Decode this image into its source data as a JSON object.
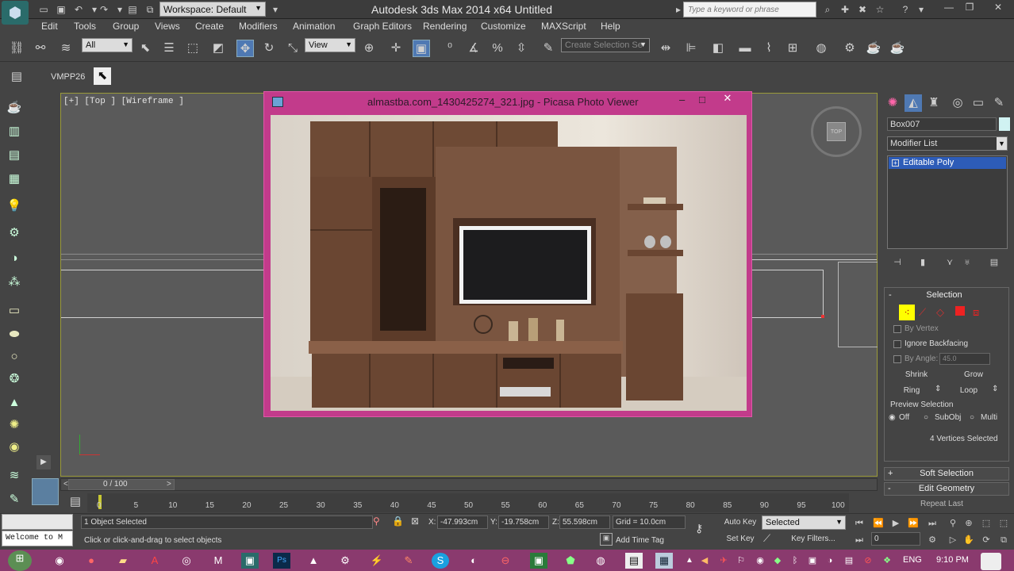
{
  "titlebar": {
    "app_icon": "3ds-max-logo-icon",
    "workspace": "Workspace: Default",
    "title": "Autodesk 3ds Max  2014 x64       Untitled",
    "search_placeholder": "Type a keyword or phrase"
  },
  "menubar": [
    "Edit",
    "Tools",
    "Group",
    "Views",
    "Create",
    "Modifiers",
    "Animation",
    "Graph Editors",
    "Rendering",
    "Customize",
    "MAXScript",
    "Help"
  ],
  "toolbar": {
    "selection_filter": "All",
    "ref_coord": "View",
    "named_selection_placeholder": "Create Selection Se"
  },
  "ribbon": {
    "label": "VMPP26"
  },
  "viewport": {
    "label": "[+] [Top ] [Wireframe ]"
  },
  "picasa": {
    "title": "almastba.com_1430425274_321.jpg - Picasa Photo Viewer",
    "min": "‒",
    "max": "□",
    "close": "✕"
  },
  "command_panel": {
    "object_name": "Box007",
    "modifier_list": "Modifier List",
    "stack_item": "Editable Poly",
    "selection_rollout": "Selection",
    "by_vertex": "By Vertex",
    "ignore_backfacing": "Ignore Backfacing",
    "by_angle": "By Angle:",
    "angle_value": "45.0",
    "shrink": "Shrink",
    "grow": "Grow",
    "ring": "Ring",
    "loop": "Loop",
    "preview_selection": "Preview Selection",
    "preview_off": "Off",
    "preview_subobj": "SubObj",
    "preview_multi": "Multi",
    "selected_info": "4 Vertices Selected",
    "soft_selection": "Soft Selection",
    "edit_geometry": "Edit Geometry",
    "repeat_last": "Repeat Last"
  },
  "timeline": {
    "position": "0 / 100",
    "ticks": [
      "0",
      "5",
      "10",
      "15",
      "20",
      "25",
      "30",
      "35",
      "40",
      "45",
      "50",
      "55",
      "60",
      "65",
      "70",
      "75",
      "80",
      "85",
      "90",
      "95",
      "100"
    ]
  },
  "statusbar": {
    "maxscript": "Welcome to M",
    "selected": "1 Object Selected",
    "prompt": "Click or click-and-drag to select objects",
    "x_label": "X:",
    "x": "-47.993cm",
    "y_label": "Y:",
    "y": "-19.758cm",
    "z_label": "Z:",
    "z": "55.598cm",
    "grid": "Grid = 10.0cm",
    "auto_key": "Auto Key",
    "key_mode": "Selected",
    "set_key": "Set Key",
    "key_filters": "Key Filters...",
    "add_time_tag": "Add Time Tag",
    "frame": "0"
  },
  "taskbar": {
    "lang": "ENG",
    "time": "9:10 PM"
  }
}
